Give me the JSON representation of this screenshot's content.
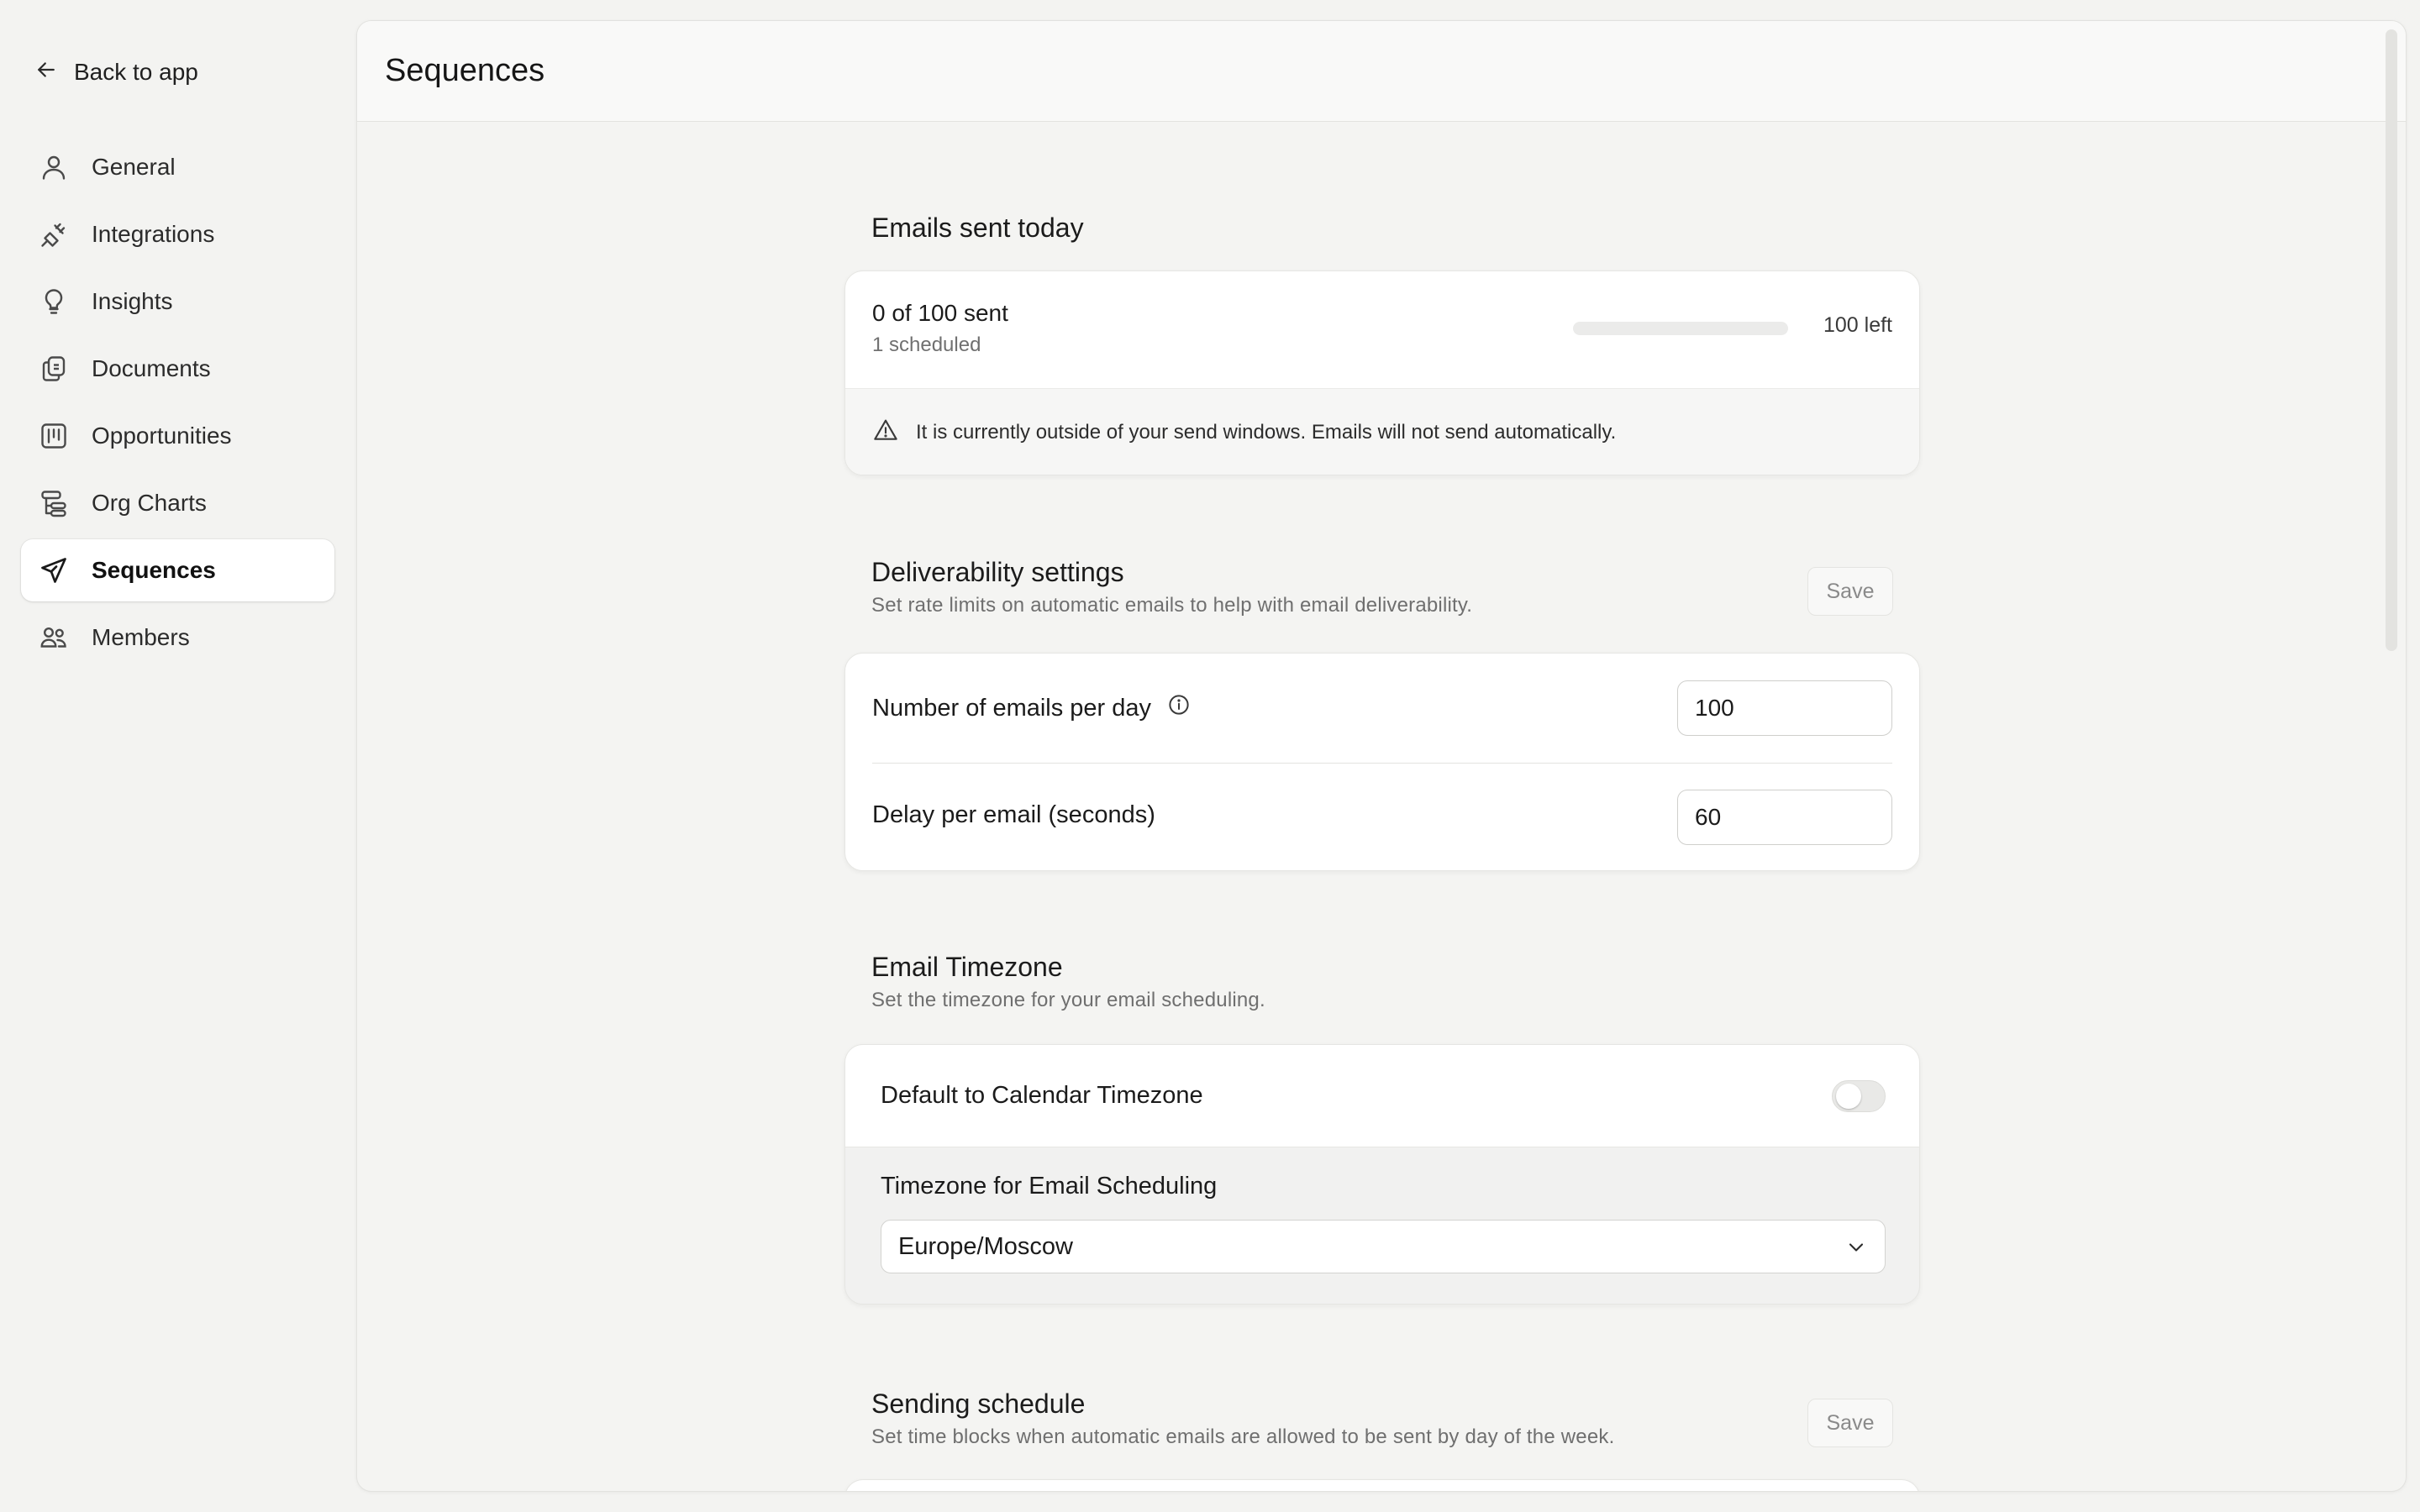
{
  "sidebar": {
    "back_label": "Back to app",
    "items": [
      {
        "label": "General",
        "icon": "user-icon"
      },
      {
        "label": "Integrations",
        "icon": "plug-icon"
      },
      {
        "label": "Insights",
        "icon": "lightbulb-icon"
      },
      {
        "label": "Documents",
        "icon": "documents-icon"
      },
      {
        "label": "Opportunities",
        "icon": "kanban-icon"
      },
      {
        "label": "Org Charts",
        "icon": "org-chart-icon"
      },
      {
        "label": "Sequences",
        "icon": "paper-plane-icon",
        "active": true
      },
      {
        "label": "Members",
        "icon": "users-icon"
      }
    ]
  },
  "header": {
    "title": "Sequences"
  },
  "emails_today": {
    "title": "Emails sent today",
    "sent_text": "0 of 100 sent",
    "scheduled_text": "1 scheduled",
    "progress_fraction": 0,
    "left_text": "100 left",
    "warning": "It is currently outside of your send windows. Emails will not send automatically."
  },
  "deliverability": {
    "title": "Deliverability settings",
    "subtitle": "Set rate limits on automatic emails to help with email deliverability.",
    "save_label": "Save",
    "emails_per_day_label": "Number of emails per day",
    "emails_per_day_value": "100",
    "delay_label": "Delay per email (seconds)",
    "delay_value": "60"
  },
  "timezone": {
    "title": "Email Timezone",
    "subtitle": "Set the timezone for your email scheduling.",
    "default_toggle_label": "Default to Calendar Timezone",
    "default_toggle_on": false,
    "select_label": "Timezone for Email Scheduling",
    "selected": "Europe/Moscow"
  },
  "schedule": {
    "title": "Sending schedule",
    "subtitle": "Set time blocks when automatic emails are allowed to be sent by day of the week.",
    "save_label": "Save"
  }
}
